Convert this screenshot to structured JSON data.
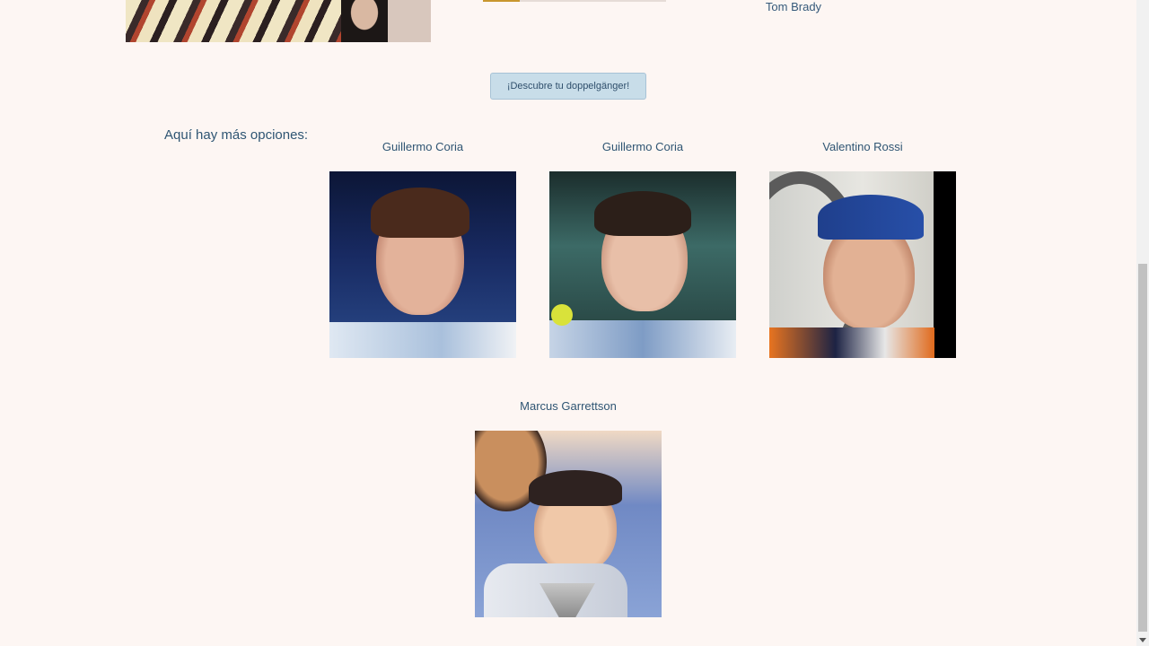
{
  "top_match": {
    "name": "Tom Brady",
    "progress_fraction": 0.2
  },
  "actions": {
    "discover_label": "¡Descubre tu doppelgänger!"
  },
  "more_options": {
    "label": "Aquí hay más opciones:",
    "cards": [
      {
        "name": "Guillermo Coria"
      },
      {
        "name": "Guillermo Coria"
      },
      {
        "name": "Valentino Rossi"
      },
      {
        "name": "Marcus Garrettson"
      }
    ]
  },
  "colors": {
    "background": "#fdf6f3",
    "text": "#2f5573",
    "button_bg": "#c8dde9",
    "progress_fill": "#c8962e"
  }
}
